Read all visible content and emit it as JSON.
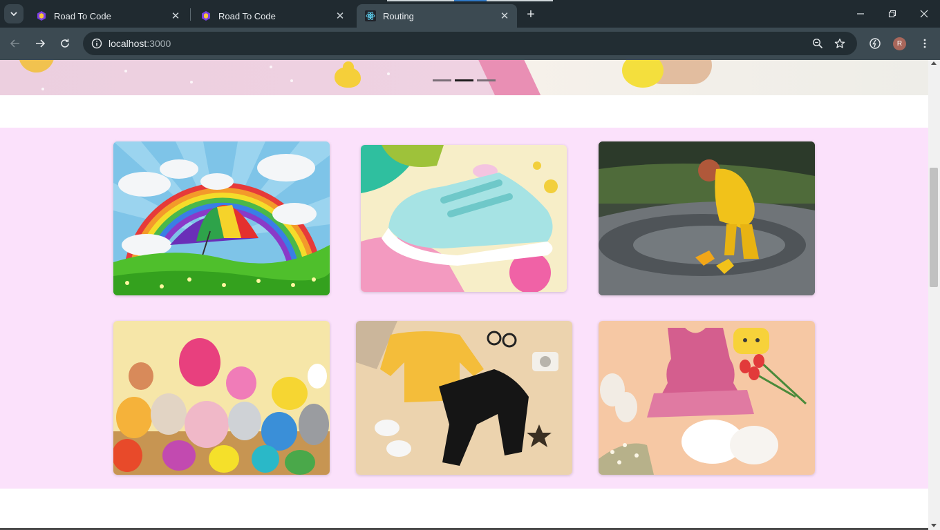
{
  "browser": {
    "tabs": [
      {
        "title": "Road To Code",
        "favicon": "hexagon-favicon",
        "active": false
      },
      {
        "title": "Road To Code",
        "favicon": "hexagon-favicon",
        "active": false
      },
      {
        "title": "Routing",
        "favicon": "react-favicon",
        "active": true
      }
    ],
    "new_tab_label": "+",
    "url_host": "localhost",
    "url_port": ":3000",
    "profile_initial": "R",
    "accent_color": "#3c4a52"
  },
  "page": {
    "banner": {
      "slides_total": 3,
      "active_slide": 2
    },
    "gallery": {
      "background_color": "#fbe1fb",
      "images": [
        {
          "subject": "rainbow-umbrella-illustration"
        },
        {
          "subject": "mint-baby-sneakers"
        },
        {
          "subject": "child-in-yellow-raincoat-puddle"
        },
        {
          "subject": "stuffed-toys-pile"
        },
        {
          "subject": "yellow-sweater-black-pants-outfit"
        },
        {
          "subject": "pink-ruffle-dress-outfit"
        }
      ]
    }
  }
}
